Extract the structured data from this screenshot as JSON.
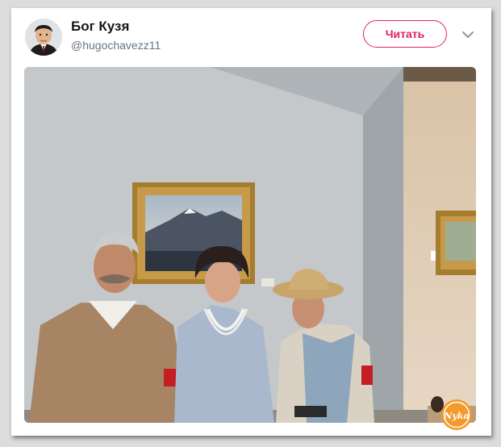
{
  "tweet": {
    "author_name": "Бог Кузя",
    "author_handle": "@hugochavezz11",
    "follow_label": "Читать",
    "menu_icon": "chevron-down-icon"
  },
  "watermark": {
    "text": "Nyka"
  },
  "colors": {
    "accent": "#e0245e",
    "handle": "#657786",
    "name": "#14171a"
  }
}
